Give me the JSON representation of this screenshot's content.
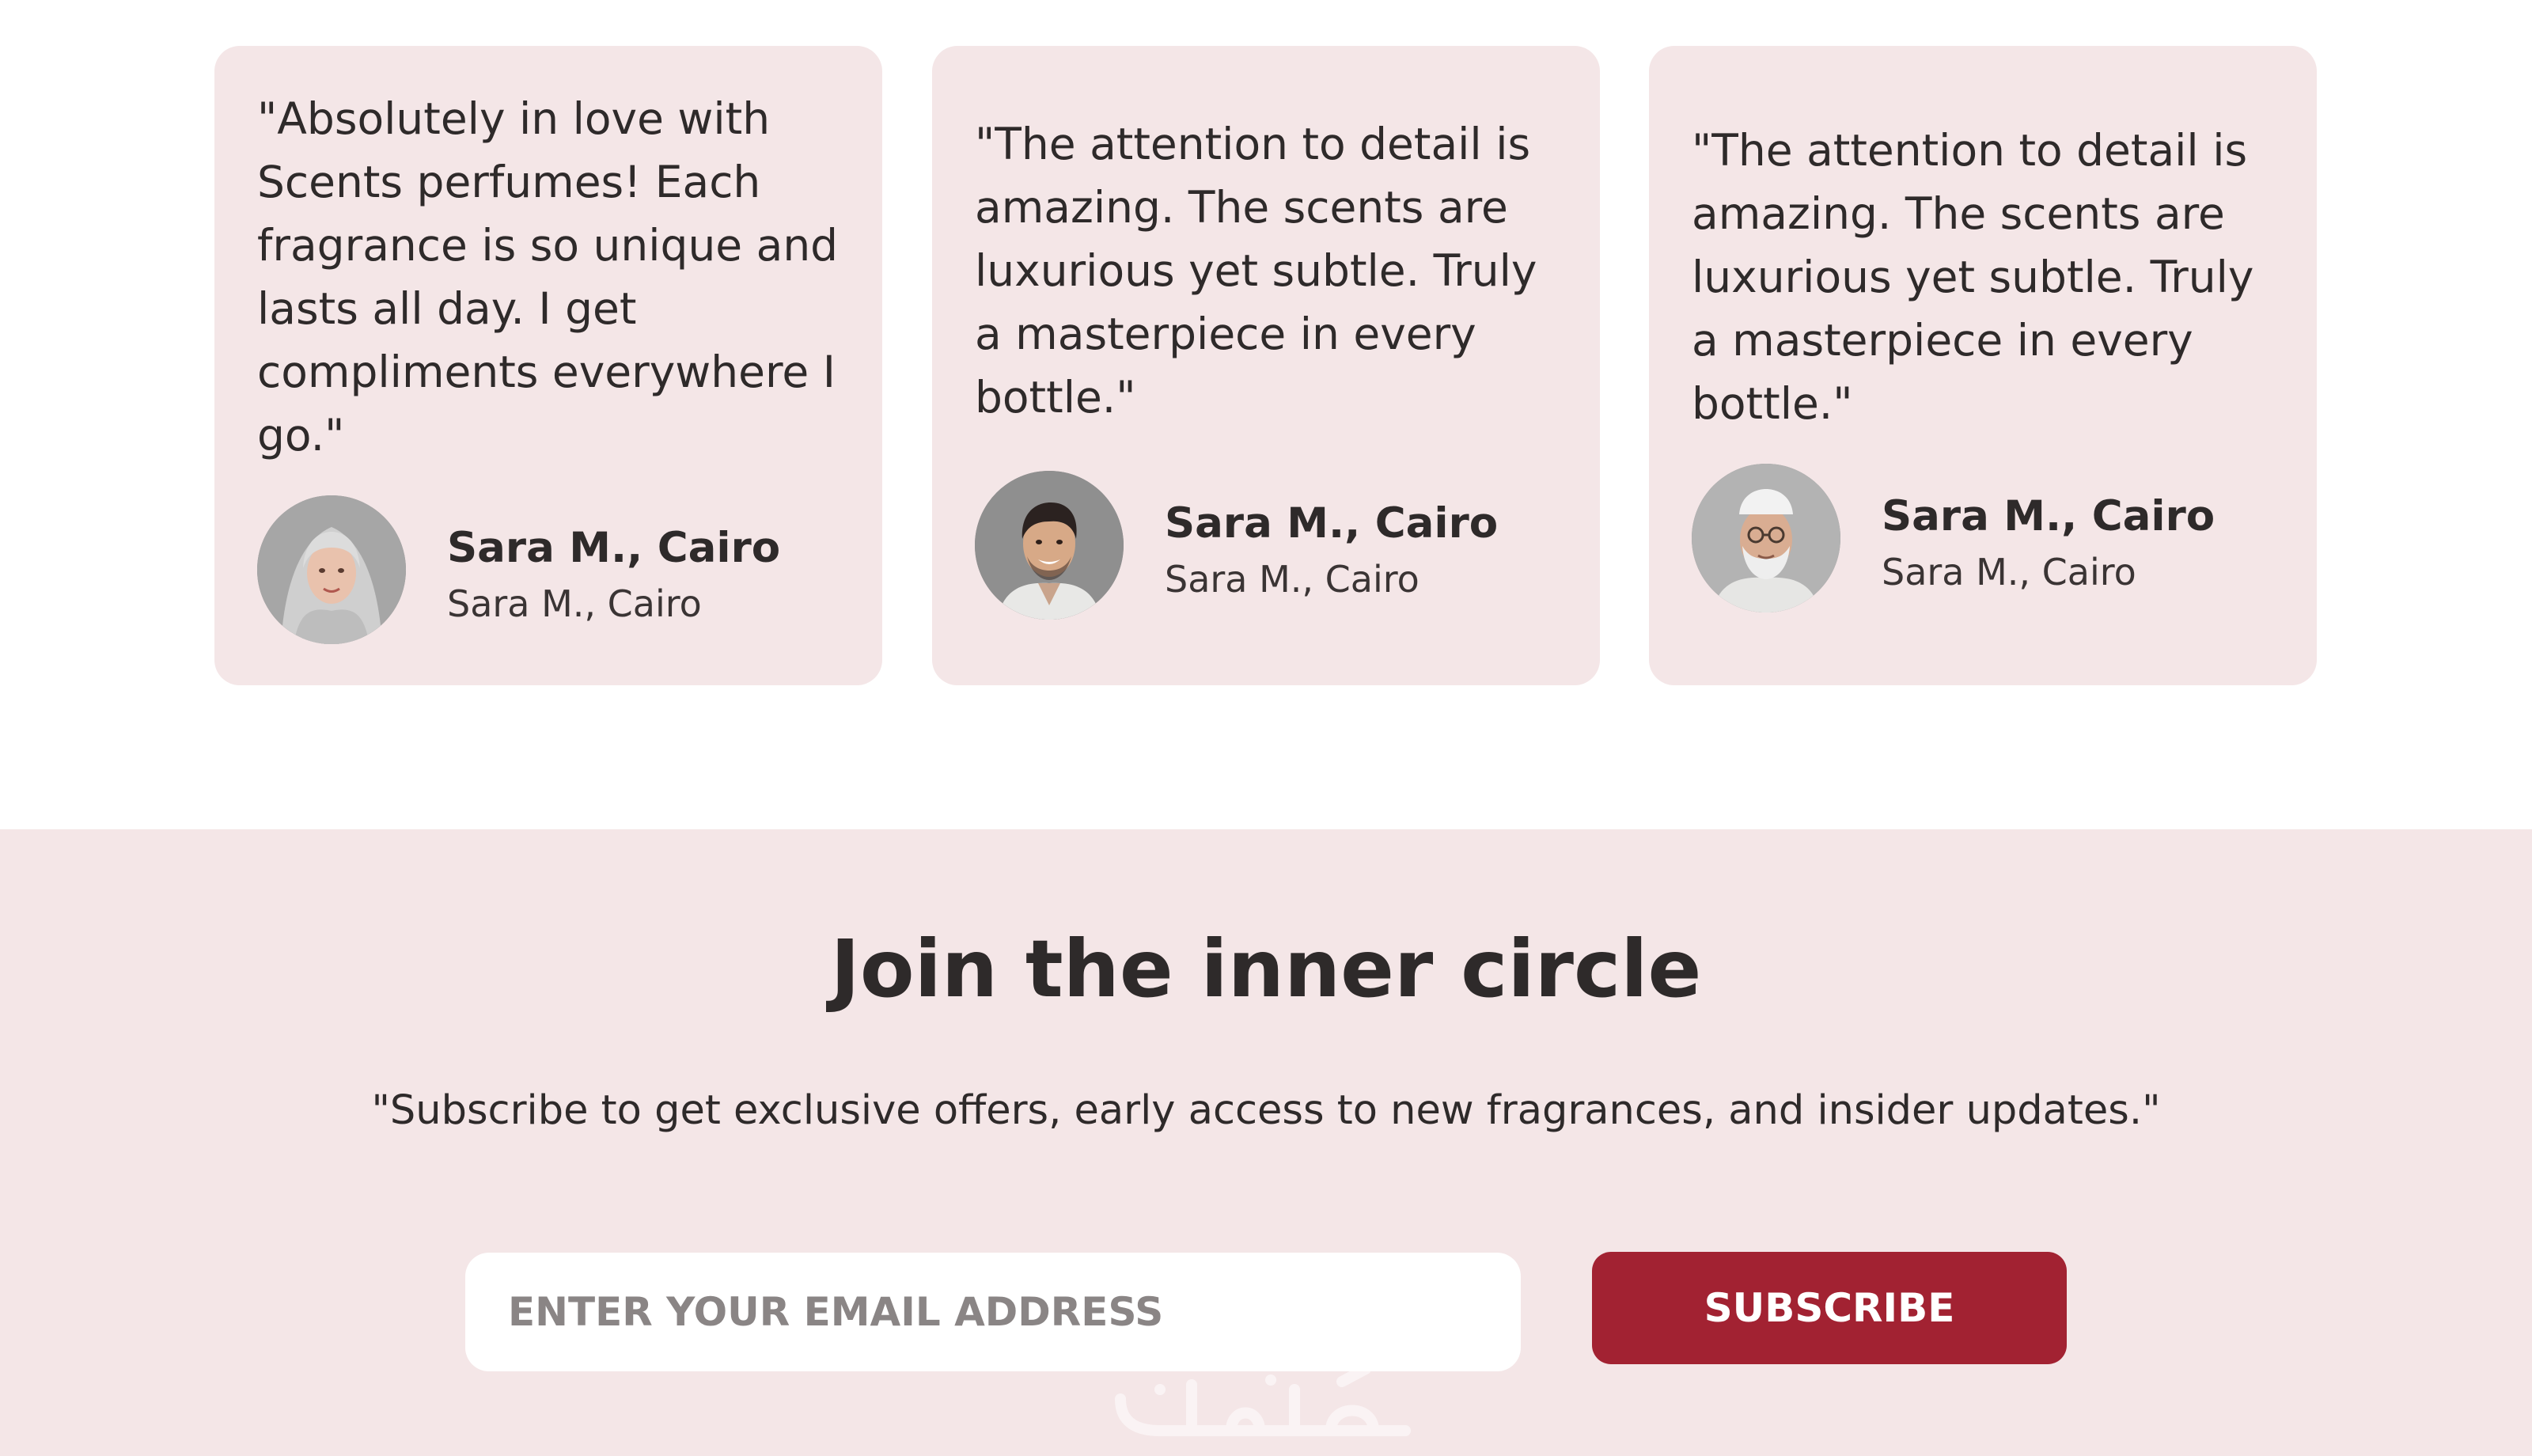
{
  "testimonials": [
    {
      "quote": "\"Absolutely in love with Scents perfumes! Each fragrance is so unique and lasts all day. I get compliments everywhere I go.\"",
      "name": "Sara M., Cairo",
      "location": "Sara M., Cairo",
      "avatar": "woman-hijab-portrait"
    },
    {
      "quote": "\"The attention to detail is amazing. The scents are luxurious yet subtle. Truly a masterpiece in every bottle.\"",
      "name": "Sara M., Cairo",
      "location": "Sara M., Cairo",
      "avatar": "young-man-portrait"
    },
    {
      "quote": "\"The attention to detail is amazing. The scents are luxurious yet subtle. Truly a masterpiece in every bottle.\"",
      "name": "Sara M., Cairo",
      "location": "Sara M., Cairo",
      "avatar": "elderly-man-portrait"
    }
  ],
  "newsletter": {
    "title": "Join the inner circle",
    "subtitle": "\"Subscribe to get exclusive offers, early access to new fragrances, and insider updates.\"",
    "email_placeholder": "ENTER YOUR EMAIL ADDRESS",
    "email_value": "",
    "subscribe_label": "SUBSCRIBE"
  },
  "watermark": {
    "text": "خمسات"
  },
  "colors": {
    "card_background": "#f4e6e7",
    "section_background": "#f4e6e7",
    "text": "#2e2a2a",
    "accent": "#a22232",
    "placeholder": "#8a8585"
  }
}
